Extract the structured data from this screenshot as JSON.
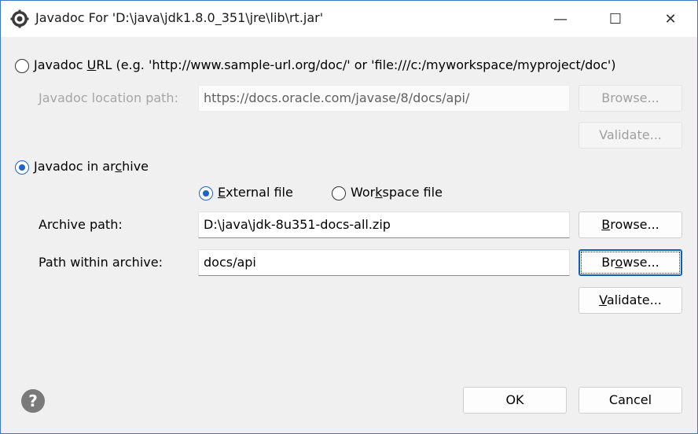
{
  "window": {
    "title": "Javadoc For 'D:\\java\\jdk1.8.0_351\\jre\\lib\\rt.jar'",
    "icon": "gear-icon",
    "controls": {
      "minimize": "—",
      "maximize": "☐",
      "close": "✕"
    }
  },
  "url_option": {
    "label_pre": "Javadoc ",
    "label_mnemonic": "U",
    "label_post": "RL (e.g. 'http://www.sample-url.org/doc/' or 'file:///c:/myworkspace/myproject/doc')",
    "selected": false,
    "location_label": "Javadoc location path:",
    "location_value": "https://docs.oracle.com/javase/8/docs/api/",
    "browse_label": "Browse...",
    "validate_label": "Validate..."
  },
  "archive_option": {
    "label_pre": "Javadoc in ar",
    "label_mnemonic": "c",
    "label_post": "hive",
    "selected": true,
    "external": {
      "label_pre": "",
      "label_mnemonic": "E",
      "label_post": "xternal file",
      "selected": true
    },
    "workspace": {
      "label_pre": "Wor",
      "label_mnemonic": "k",
      "label_post": "space file",
      "selected": false
    },
    "archive_path_label": "Archive path:",
    "archive_path_value": "D:\\java\\jdk-8u351-docs-all.zip",
    "archive_browse": {
      "pre": "",
      "mnemonic": "B",
      "post": "rowse..."
    },
    "path_within_label": "Path within archive:",
    "path_within_value": "docs/api",
    "path_browse": {
      "pre": "Br",
      "mnemonic": "o",
      "post": "wse..."
    },
    "validate": {
      "pre": "",
      "mnemonic": "V",
      "post": "alidate..."
    }
  },
  "footer": {
    "help_icon": "help-icon",
    "help_glyph": "?",
    "ok_label": "OK",
    "cancel_label": "Cancel"
  },
  "colors": {
    "accent": "#1e64c8",
    "border": "#3b76c9",
    "dialog_bg": "#f0f0f0"
  }
}
